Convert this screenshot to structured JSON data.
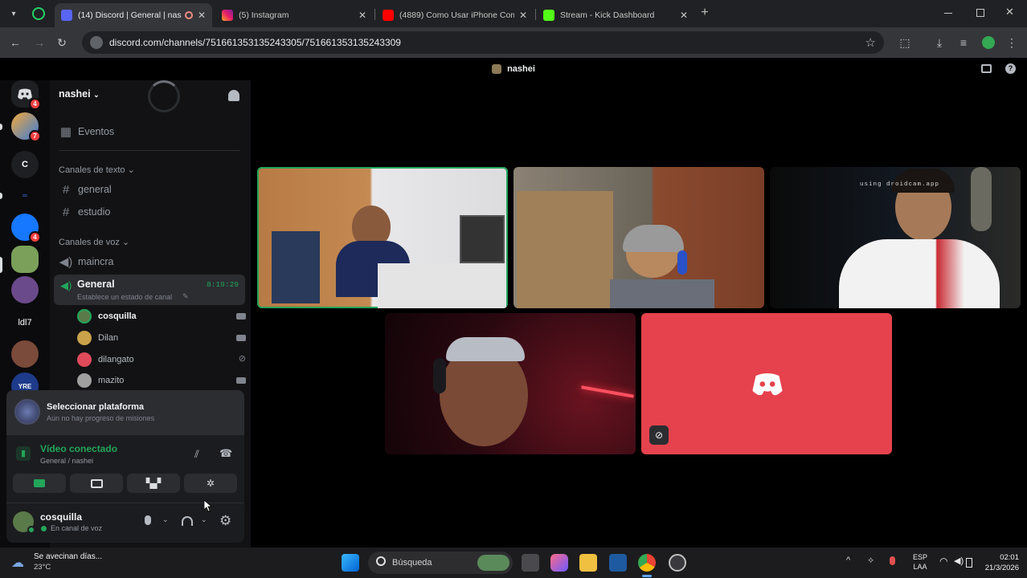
{
  "browser": {
    "tabs": [
      {
        "title": "(14) Discord | General | nashei",
        "active": true
      },
      {
        "title": "(5) Instagram",
        "active": false
      },
      {
        "title": "(4889) Como Usar iPhone Como...",
        "active": false
      },
      {
        "title": "Stream - Kick Dashboard",
        "active": false
      }
    ],
    "url": "discord.com/channels/751661353135243305/751661353135243309"
  },
  "discord": {
    "window_title": "nashei",
    "rail": {
      "dm_badge": "4",
      "items": [
        {
          "label": "",
          "badge": "7"
        },
        {
          "label": "C",
          "badge": ""
        },
        {
          "label": "",
          "badge": ""
        },
        {
          "label": "",
          "badge": "4"
        },
        {
          "label": "",
          "badge": ""
        },
        {
          "label": "",
          "badge": ""
        },
        {
          "label": "ldl7",
          "badge": ""
        },
        {
          "label": "",
          "badge": ""
        },
        {
          "label": "YRE",
          "badge": ""
        }
      ]
    },
    "server_name": "nashei",
    "events_label": "Eventos",
    "text_category": "Canales de texto",
    "text_channels": [
      "general",
      "estudio"
    ],
    "voice_category": "Canales de voz",
    "voice_channels": {
      "first": "maincra",
      "active": {
        "name": "General",
        "timer": "8:19:29",
        "status_hint": "Establece un estado de canal"
      }
    },
    "members": [
      {
        "name": "cosquilla",
        "color": "#5a7a4a"
      },
      {
        "name": "Dilan",
        "color": "#c9a24a"
      },
      {
        "name": "dilangato",
        "color": "#e04b5b"
      },
      {
        "name": "mazito",
        "color": "#a0a0a0"
      }
    ],
    "quest": {
      "title": "Seleccionar plataforma",
      "subtitle": "Aún no hay progreso de misiones"
    },
    "voice": {
      "status": "Vídeo conectado",
      "location": "General / nashei"
    },
    "user": {
      "name": "cosquilla",
      "status": "En canal de voz"
    },
    "stage": {
      "watermark": "using droidcam.app",
      "tiles": [
        {
          "who": "player-1",
          "speaking": true
        },
        {
          "who": "player-2",
          "speaking": false
        },
        {
          "who": "player-3",
          "speaking": false
        },
        {
          "who": "player-4",
          "speaking": false
        },
        {
          "who": "camera-off",
          "speaking": false
        }
      ],
      "accent": "#e5424d"
    }
  },
  "taskbar": {
    "weather_text": "Se avecinan días...",
    "temperature": "23°C",
    "search_label": "Búsqueda",
    "language": "ESP",
    "keyboard": "LAA",
    "time": "02:01",
    "date": "21/3/2026"
  }
}
